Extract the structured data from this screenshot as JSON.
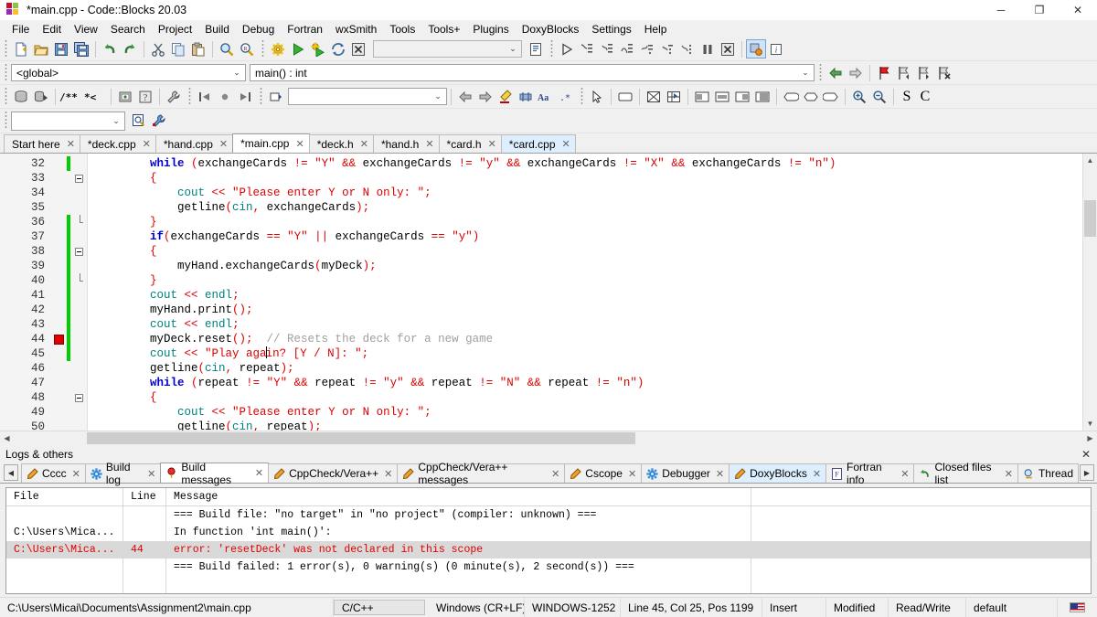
{
  "window": {
    "title": "*main.cpp - Code::Blocks 20.03",
    "minimize": "─",
    "maximize": "❐",
    "close": "✕"
  },
  "menubar": [
    {
      "label": "File"
    },
    {
      "label": "Edit"
    },
    {
      "label": "View"
    },
    {
      "label": "Search"
    },
    {
      "label": "Project"
    },
    {
      "label": "Build"
    },
    {
      "label": "Debug"
    },
    {
      "label": "Fortran"
    },
    {
      "label": "wxSmith"
    },
    {
      "label": "Tools"
    },
    {
      "label": "Tools+"
    },
    {
      "label": "Plugins"
    },
    {
      "label": "DoxyBlocks"
    },
    {
      "label": "Settings"
    },
    {
      "label": "Help"
    }
  ],
  "toolbar": {
    "target_combo_value": "",
    "scope_combo_value": "<global>",
    "function_combo_value": "main() : int",
    "doxy_combo_value": "",
    "search_combo_value": "",
    "arrow_glyph": "⌄",
    "scope_button": "S",
    "class_button": "C"
  },
  "editor_tabs": [
    {
      "label": "Start here",
      "state": "normal"
    },
    {
      "label": "*deck.cpp",
      "state": "normal"
    },
    {
      "label": "*hand.cpp",
      "state": "normal"
    },
    {
      "label": "*main.cpp",
      "state": "active"
    },
    {
      "label": "*deck.h",
      "state": "normal"
    },
    {
      "label": "*hand.h",
      "state": "normal"
    },
    {
      "label": "*card.h",
      "state": "normal"
    },
    {
      "label": "*card.cpp",
      "state": "selected"
    }
  ],
  "tab_close_glyph": "✕",
  "editor": {
    "first_line": 32,
    "lines": [
      {
        "n": 32,
        "changed": true,
        "fold": "none",
        "error": false,
        "tokens": [
          {
            "t": "kw",
            "v": "        while "
          },
          {
            "t": "op",
            "v": "("
          },
          {
            "t": "id",
            "v": "exchangeCards "
          },
          {
            "t": "op",
            "v": "!="
          },
          {
            "t": "id",
            "v": " "
          },
          {
            "t": "str",
            "v": "\"Y\""
          },
          {
            "t": "op",
            "v": " && "
          },
          {
            "t": "id",
            "v": "exchangeCards "
          },
          {
            "t": "op",
            "v": "!="
          },
          {
            "t": "id",
            "v": " "
          },
          {
            "t": "str",
            "v": "\"y\""
          },
          {
            "t": "op",
            "v": " && "
          },
          {
            "t": "id",
            "v": "exchangeCards "
          },
          {
            "t": "op",
            "v": "!="
          },
          {
            "t": "id",
            "v": " "
          },
          {
            "t": "str",
            "v": "\"X\""
          },
          {
            "t": "op",
            "v": " && "
          },
          {
            "t": "id",
            "v": "exchangeCards "
          },
          {
            "t": "op",
            "v": "!="
          },
          {
            "t": "id",
            "v": " "
          },
          {
            "t": "str",
            "v": "\"n\""
          },
          {
            "t": "op",
            "v": ")"
          }
        ]
      },
      {
        "n": 33,
        "changed": false,
        "fold": "open",
        "error": false,
        "tokens": [
          {
            "t": "op",
            "v": "        {"
          }
        ]
      },
      {
        "n": 34,
        "changed": false,
        "fold": "none",
        "error": false,
        "tokens": [
          {
            "t": "std",
            "v": "            cout "
          },
          {
            "t": "op",
            "v": "<< "
          },
          {
            "t": "str",
            "v": "\"Please enter Y or N only: \""
          },
          {
            "t": "op",
            "v": ";"
          }
        ]
      },
      {
        "n": 35,
        "changed": false,
        "fold": "none",
        "error": false,
        "tokens": [
          {
            "t": "id",
            "v": "            getline"
          },
          {
            "t": "op",
            "v": "("
          },
          {
            "t": "std",
            "v": "cin"
          },
          {
            "t": "op",
            "v": ","
          },
          {
            "t": "id",
            "v": " exchangeCards"
          },
          {
            "t": "op",
            "v": ");"
          }
        ]
      },
      {
        "n": 36,
        "changed": true,
        "fold": "tail",
        "error": false,
        "tokens": [
          {
            "t": "op",
            "v": "        }"
          }
        ]
      },
      {
        "n": 37,
        "changed": true,
        "fold": "none",
        "error": false,
        "tokens": [
          {
            "t": "kw",
            "v": "        if"
          },
          {
            "t": "op",
            "v": "("
          },
          {
            "t": "id",
            "v": "exchangeCards "
          },
          {
            "t": "op",
            "v": "=="
          },
          {
            "t": "id",
            "v": " "
          },
          {
            "t": "str",
            "v": "\"Y\""
          },
          {
            "t": "op",
            "v": " || "
          },
          {
            "t": "id",
            "v": "exchangeCards "
          },
          {
            "t": "op",
            "v": "=="
          },
          {
            "t": "id",
            "v": " "
          },
          {
            "t": "str",
            "v": "\"y\""
          },
          {
            "t": "op",
            "v": ")"
          }
        ]
      },
      {
        "n": 38,
        "changed": true,
        "fold": "open",
        "error": false,
        "tokens": [
          {
            "t": "op",
            "v": "        {"
          }
        ]
      },
      {
        "n": 39,
        "changed": true,
        "fold": "none",
        "error": false,
        "tokens": [
          {
            "t": "id",
            "v": "            myHand.exchangeCards"
          },
          {
            "t": "op",
            "v": "("
          },
          {
            "t": "id",
            "v": "myDeck"
          },
          {
            "t": "op",
            "v": ");"
          }
        ]
      },
      {
        "n": 40,
        "changed": true,
        "fold": "tail",
        "error": false,
        "tokens": [
          {
            "t": "op",
            "v": "        }"
          }
        ]
      },
      {
        "n": 41,
        "changed": true,
        "fold": "none",
        "error": false,
        "tokens": [
          {
            "t": "std",
            "v": "        cout "
          },
          {
            "t": "op",
            "v": "<< "
          },
          {
            "t": "std",
            "v": "endl"
          },
          {
            "t": "op",
            "v": ";"
          }
        ]
      },
      {
        "n": 42,
        "changed": true,
        "fold": "none",
        "error": false,
        "tokens": [
          {
            "t": "id",
            "v": "        myHand.print"
          },
          {
            "t": "op",
            "v": "();"
          }
        ]
      },
      {
        "n": 43,
        "changed": true,
        "fold": "none",
        "error": false,
        "tokens": [
          {
            "t": "std",
            "v": "        cout "
          },
          {
            "t": "op",
            "v": "<< "
          },
          {
            "t": "std",
            "v": "endl"
          },
          {
            "t": "op",
            "v": ";"
          }
        ]
      },
      {
        "n": 44,
        "changed": true,
        "fold": "none",
        "error": true,
        "tokens": [
          {
            "t": "id",
            "v": "        myDeck.reset"
          },
          {
            "t": "op",
            "v": "();"
          },
          {
            "t": "cm",
            "v": "  // Resets the deck for a new game"
          }
        ]
      },
      {
        "n": 45,
        "changed": true,
        "fold": "none",
        "error": false,
        "caret_after": 24,
        "tokens": [
          {
            "t": "std",
            "v": "        cout "
          },
          {
            "t": "op",
            "v": "<< "
          },
          {
            "t": "str",
            "v": "\"Play again? [Y / N]: \""
          },
          {
            "t": "op",
            "v": ";"
          }
        ]
      },
      {
        "n": 46,
        "changed": false,
        "fold": "none",
        "error": false,
        "tokens": [
          {
            "t": "id",
            "v": "        getline"
          },
          {
            "t": "op",
            "v": "("
          },
          {
            "t": "std",
            "v": "cin"
          },
          {
            "t": "op",
            "v": ","
          },
          {
            "t": "id",
            "v": " repeat"
          },
          {
            "t": "op",
            "v": ");"
          }
        ]
      },
      {
        "n": 47,
        "changed": false,
        "fold": "none",
        "error": false,
        "tokens": [
          {
            "t": "kw",
            "v": "        while "
          },
          {
            "t": "op",
            "v": "("
          },
          {
            "t": "id",
            "v": "repeat "
          },
          {
            "t": "op",
            "v": "!="
          },
          {
            "t": "id",
            "v": " "
          },
          {
            "t": "str",
            "v": "\"Y\""
          },
          {
            "t": "op",
            "v": " && "
          },
          {
            "t": "id",
            "v": "repeat "
          },
          {
            "t": "op",
            "v": "!="
          },
          {
            "t": "id",
            "v": " "
          },
          {
            "t": "str",
            "v": "\"y\""
          },
          {
            "t": "op",
            "v": " && "
          },
          {
            "t": "id",
            "v": "repeat "
          },
          {
            "t": "op",
            "v": "!="
          },
          {
            "t": "id",
            "v": " "
          },
          {
            "t": "str",
            "v": "\"N\""
          },
          {
            "t": "op",
            "v": " && "
          },
          {
            "t": "id",
            "v": "repeat "
          },
          {
            "t": "op",
            "v": "!="
          },
          {
            "t": "id",
            "v": " "
          },
          {
            "t": "str",
            "v": "\"n\""
          },
          {
            "t": "op",
            "v": ")"
          }
        ]
      },
      {
        "n": 48,
        "changed": false,
        "fold": "open",
        "error": false,
        "tokens": [
          {
            "t": "op",
            "v": "        {"
          }
        ]
      },
      {
        "n": 49,
        "changed": false,
        "fold": "none",
        "error": false,
        "tokens": [
          {
            "t": "std",
            "v": "            cout "
          },
          {
            "t": "op",
            "v": "<< "
          },
          {
            "t": "str",
            "v": "\"Please enter Y or N only: \""
          },
          {
            "t": "op",
            "v": ";"
          }
        ]
      },
      {
        "n": 50,
        "changed": false,
        "fold": "none",
        "error": false,
        "tokens": [
          {
            "t": "id",
            "v": "            getline"
          },
          {
            "t": "op",
            "v": "("
          },
          {
            "t": "std",
            "v": "cin"
          },
          {
            "t": "op",
            "v": ","
          },
          {
            "t": "id",
            "v": " repeat"
          },
          {
            "t": "op",
            "v": ");"
          }
        ]
      }
    ]
  },
  "logs": {
    "title": "Logs & others",
    "close_glyph": "✕",
    "nav_left": "◀",
    "nav_right": "▶",
    "tabs": [
      {
        "label": "Cccc",
        "icon": "pencil-icon",
        "state": "normal"
      },
      {
        "label": "Build log",
        "icon": "gear-icon",
        "state": "normal"
      },
      {
        "label": "Build messages",
        "icon": "balloon-icon",
        "state": "active"
      },
      {
        "label": "CppCheck/Vera++",
        "icon": "pencil-icon",
        "state": "normal"
      },
      {
        "label": "CppCheck/Vera++ messages",
        "icon": "pencil-icon",
        "state": "normal"
      },
      {
        "label": "Cscope",
        "icon": "pencil-icon",
        "state": "normal"
      },
      {
        "label": "Debugger",
        "icon": "gear-icon",
        "state": "normal"
      },
      {
        "label": "DoxyBlocks",
        "icon": "pencil-icon",
        "state": "selected"
      },
      {
        "label": "Fortran info",
        "icon": "fortran-icon",
        "state": "normal"
      },
      {
        "label": "Closed files list",
        "icon": "undo-icon",
        "state": "normal"
      },
      {
        "label": "Thread",
        "icon": "search-icon",
        "state": "normal"
      }
    ],
    "columns": [
      "File",
      "Line",
      "Message"
    ],
    "rows": [
      {
        "file": "",
        "line": "",
        "message": "=== Build file: \"no target\" in \"no project\" (compiler: unknown) ===",
        "error": false
      },
      {
        "file": "C:\\Users\\Mica...",
        "line": "",
        "message": "In function 'int main()':",
        "error": false
      },
      {
        "file": "C:\\Users\\Mica...",
        "line": "44",
        "message": "error: 'resetDeck' was not declared in this scope",
        "error": true
      },
      {
        "file": "",
        "line": "",
        "message": "=== Build failed: 1 error(s), 0 warning(s) (0 minute(s), 2 second(s)) ===",
        "error": false
      },
      {
        "file": "",
        "line": "",
        "message": "",
        "error": false
      }
    ]
  },
  "statusbar": {
    "path": "C:\\Users\\Micai\\Documents\\Assignment2\\main.cpp",
    "language": "C/C++",
    "eol": "Windows (CR+LF)",
    "encoding": "WINDOWS-1252",
    "position": "Line 45, Col 25, Pos 1199",
    "insert_mode": "Insert",
    "modified": "Modified",
    "access": "Read/Write",
    "profile": "default"
  },
  "colors": {
    "keyword": "#0000cc",
    "string": "#dd0000",
    "comment": "#a0a0a0",
    "std": "#008080",
    "error": "#e00000",
    "changed_marker": "#00d000",
    "selected_tab": "#ddeeff"
  }
}
